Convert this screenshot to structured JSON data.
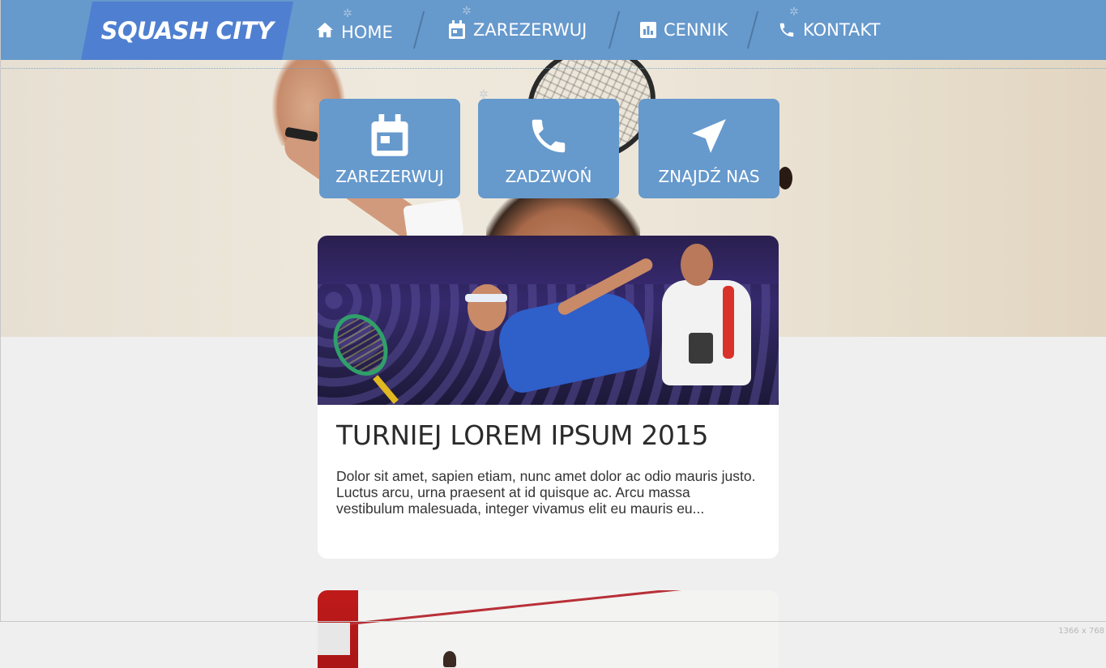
{
  "brand": {
    "name": "SQUASH CITY"
  },
  "nav": [
    {
      "label": "HOME",
      "icon": "home-icon"
    },
    {
      "label": "ZAREZERWUJ",
      "icon": "calendar-icon"
    },
    {
      "label": "CENNIK",
      "icon": "bar-chart-icon"
    },
    {
      "label": "KONTAKT",
      "icon": "phone-icon"
    }
  ],
  "actions": [
    {
      "label": "ZAREZERWUJ",
      "icon": "calendar-icon"
    },
    {
      "label": "ZADZWOŃ",
      "icon": "phone-icon"
    },
    {
      "label": "ZNAJDŹ NAS",
      "icon": "navigation-arrow-icon"
    }
  ],
  "news": [
    {
      "title": "TURNIEJ LOREM IPSUM 2015",
      "excerpt": "Dolor sit amet, sapien etiam, nunc amet dolor ac odio mauris justo. Luctus arcu, urna praesent at id quisque ac. Arcu massa vestibulum malesuada, integer vivamus elit eu mauris eu..."
    }
  ],
  "viewport_size_label": "1366 x 768",
  "colors": {
    "nav": "#6699cc",
    "logo": "#4f7fd0",
    "page_bg": "#efefef"
  }
}
